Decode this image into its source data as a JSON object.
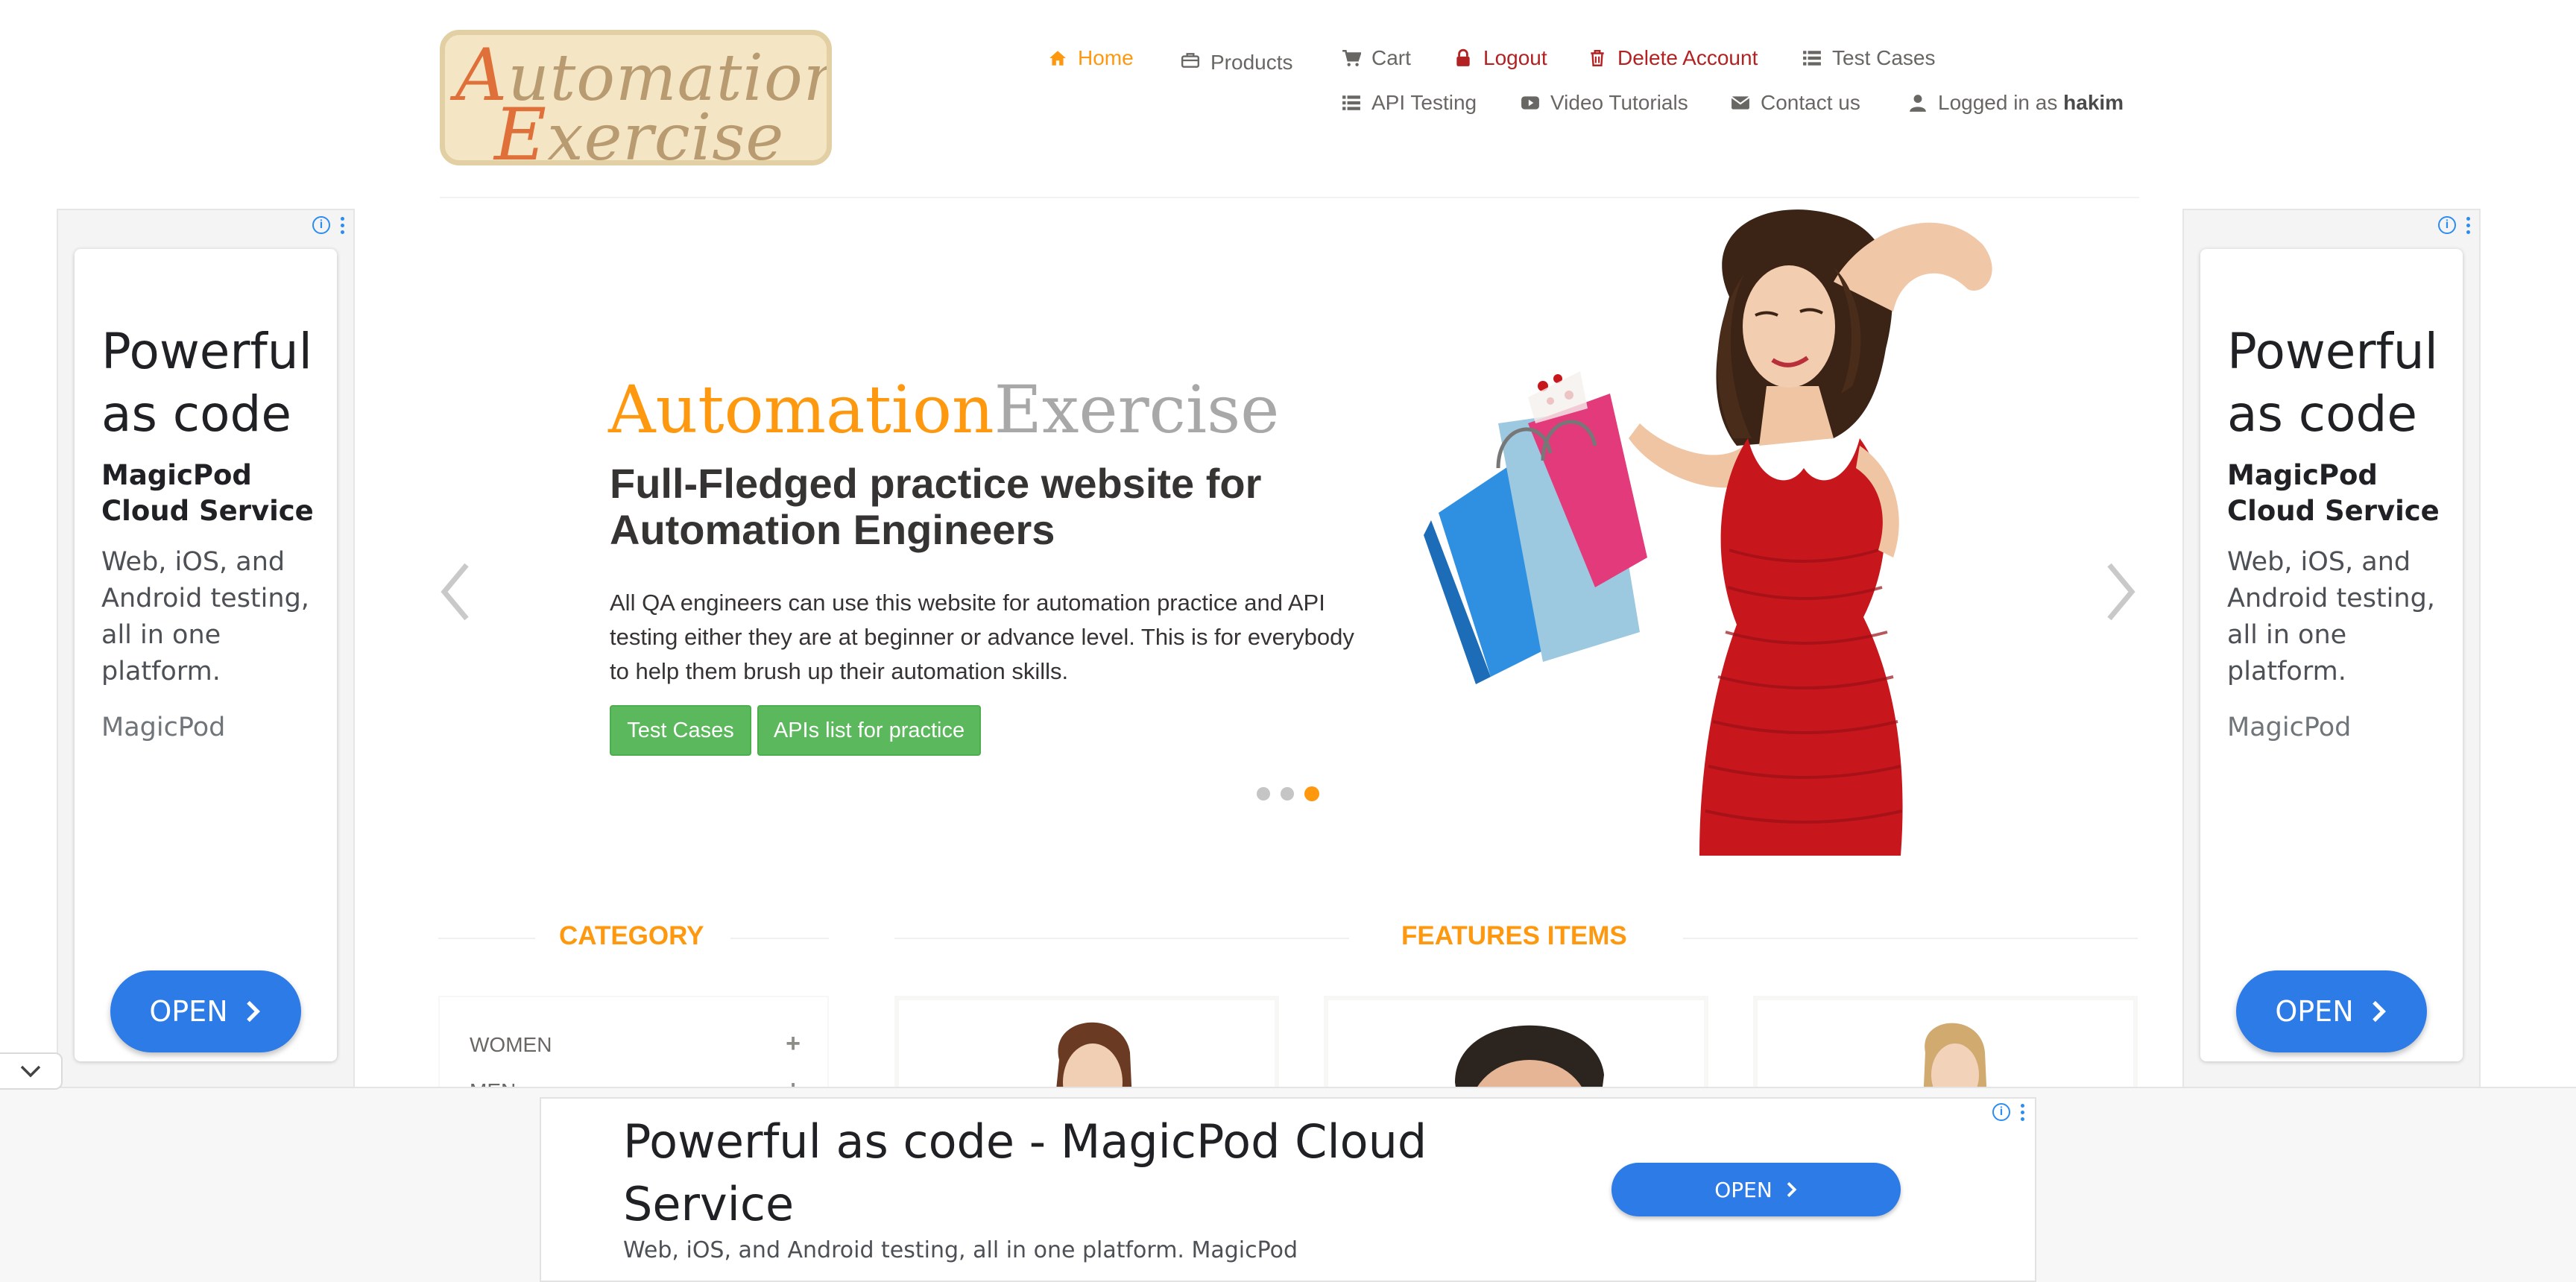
{
  "logo": {
    "line1": "Automation",
    "line2": "Exercise"
  },
  "nav": {
    "row1": [
      {
        "label": "Home",
        "icon": "home-icon"
      },
      {
        "label": "Products",
        "icon": "briefcase-icon"
      },
      {
        "label": "Cart",
        "icon": "cart-icon"
      },
      {
        "label": "Logout",
        "icon": "lock-icon"
      },
      {
        "label": "Delete Account",
        "icon": "trash-icon"
      },
      {
        "label": "Test Cases",
        "icon": "list-icon"
      }
    ],
    "row2": [
      {
        "label": "API Testing",
        "icon": "list-icon"
      },
      {
        "label": "Video Tutorials",
        "icon": "youtube-icon"
      },
      {
        "label": "Contact us",
        "icon": "envelope-icon"
      }
    ],
    "logged_in_prefix": "Logged in as",
    "username": "hakim"
  },
  "slider": {
    "title_part1": "Automation",
    "title_part2": "Exercise",
    "heading": "Full-Fledged practice website for Automation Engineers",
    "paragraph": "All QA engineers can use this website for automation practice and API testing either they are at beginner or advance level. This is for everybody to help them brush up their automation skills.",
    "btn_test_cases": "Test Cases",
    "btn_apis": "APIs list for practice",
    "dots_total": 3,
    "active_dot": 3
  },
  "side_ad": {
    "headline": "Powerful as code",
    "product": "MagicPod Cloud Service",
    "description": "Web, iOS, and Android testing, all in one platform.",
    "brand": "MagicPod",
    "button": "OPEN"
  },
  "sections": {
    "category_title": "CATEGORY",
    "features_title": "FEATURES ITEMS",
    "categories": [
      {
        "label": "WOMEN"
      },
      {
        "label": "MEN"
      }
    ]
  },
  "bottom_ad": {
    "headline": "Powerful as code - MagicPod Cloud Service",
    "description": "Web, iOS, and Android testing, all in one platform. MagicPod",
    "button": "OPEN"
  },
  "colors": {
    "brand_orange": "#fe980f",
    "green_button": "#5cb85c",
    "ad_blue": "#2d7be7",
    "dress_red": "#c8161d"
  }
}
